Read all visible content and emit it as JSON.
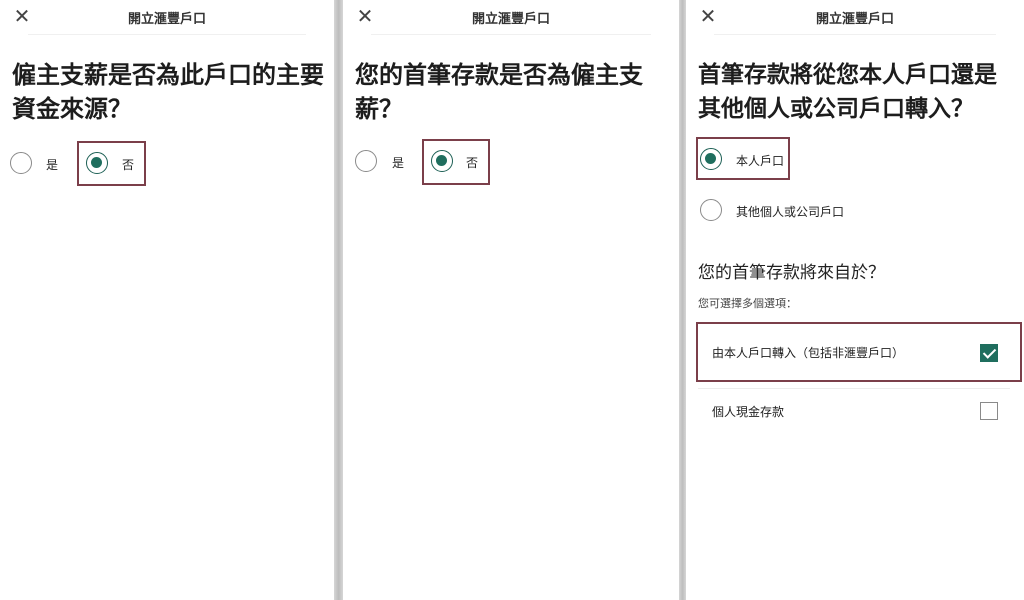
{
  "header": {
    "title": "開立滙豐戶口",
    "close_icon": "close-icon"
  },
  "panel1": {
    "question": "僱主支薪是否為此戶口的主要資金來源？",
    "options": [
      {
        "label": "是",
        "selected": false
      },
      {
        "label": "否",
        "selected": true
      }
    ]
  },
  "panel2": {
    "question": "您的首筆存款是否為僱主支薪？",
    "options": [
      {
        "label": "是",
        "selected": false
      },
      {
        "label": "否",
        "selected": true
      }
    ]
  },
  "panel3": {
    "question": "首筆存款將從您本人戶口還是其他個人或公司戶口轉入？",
    "options": [
      {
        "label": "本人戶口",
        "selected": true
      },
      {
        "label": "其他個人或公司戶口",
        "selected": false
      }
    ],
    "sub_question": "您的首筆存款將來自於？",
    "hint": "您可選擇多個選項：",
    "checkboxes": [
      {
        "label": "由本人戶口轉入（包括非滙豐戶口）",
        "checked": true
      },
      {
        "label": "個人現金存款",
        "checked": false
      }
    ]
  },
  "colors": {
    "accent": "#1f6e5e",
    "highlight_border": "#7b3f4a"
  }
}
